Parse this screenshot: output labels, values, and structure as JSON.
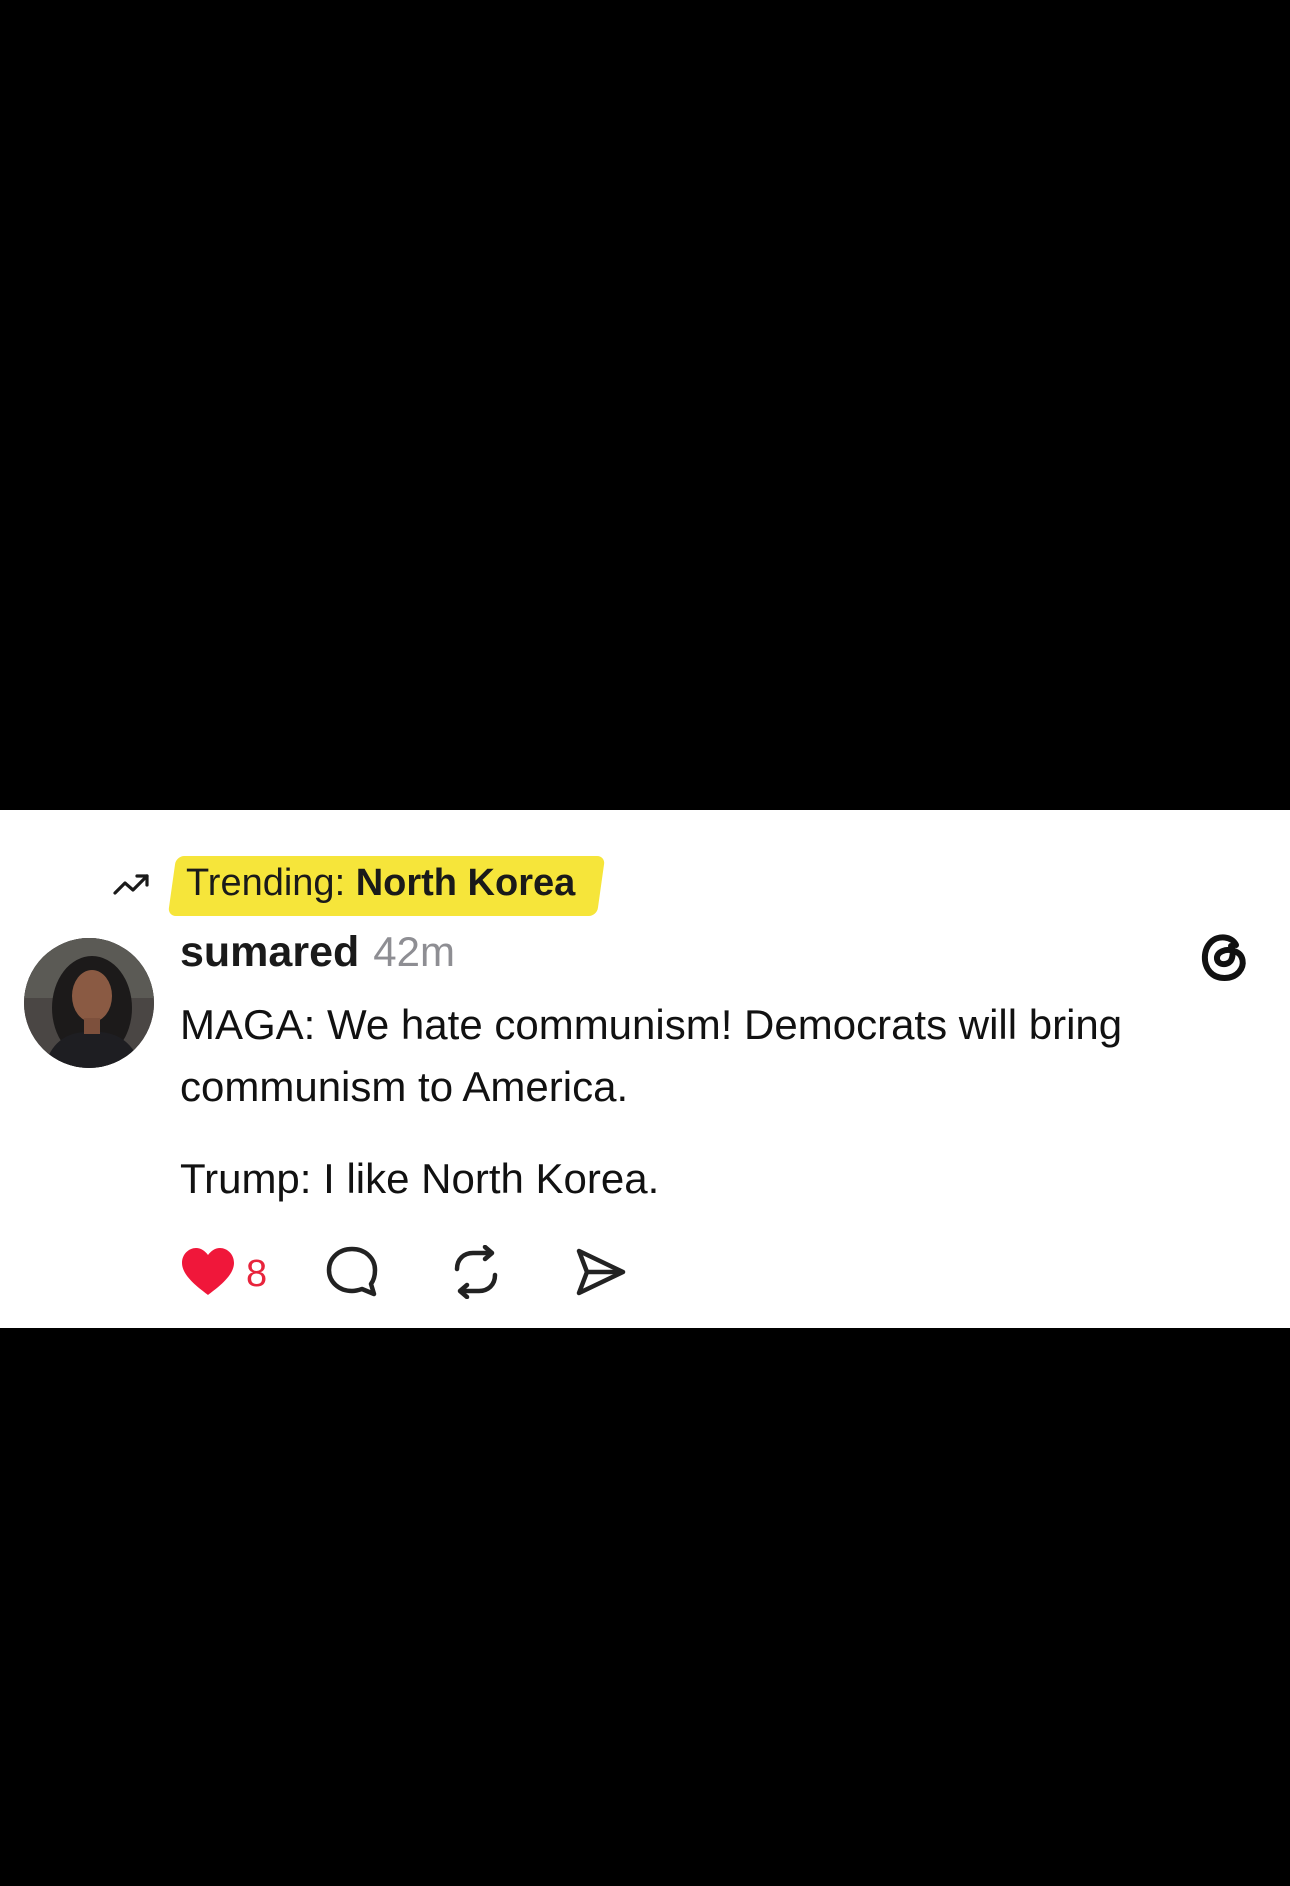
{
  "trending": {
    "label": "Trending:",
    "topic": "North Korea",
    "icon": "trending-up-icon",
    "highlight_color": "#f6e53a"
  },
  "post": {
    "username": "sumared",
    "time": "42m",
    "paragraphs": [
      "MAGA: We hate communism! Democrats will bring communism to America.",
      "Trump: I like North Korea."
    ],
    "like_count": "8",
    "like_color": "#e8243c"
  },
  "icons": {
    "threads": "threads-logo-icon",
    "like": "heart-icon",
    "comment": "comment-icon",
    "repost": "repost-icon",
    "share": "share-icon"
  }
}
